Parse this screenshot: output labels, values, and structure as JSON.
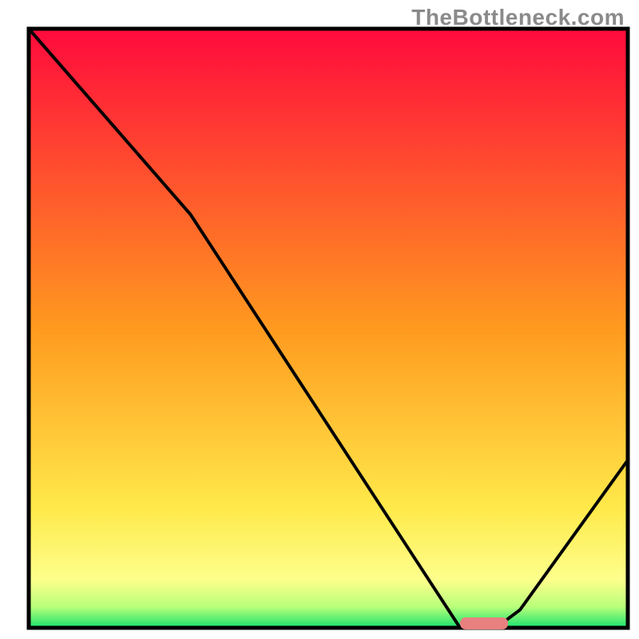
{
  "attribution": "TheBottleneck.com",
  "chart_data": {
    "type": "line",
    "title": "",
    "xlabel": "",
    "ylabel": "",
    "xlim": [
      0,
      100
    ],
    "ylim": [
      0,
      100
    ],
    "x": [
      0,
      27,
      72,
      78,
      82,
      100
    ],
    "values": [
      100,
      69,
      0,
      0,
      3,
      28
    ],
    "optimum_marker": {
      "x_start": 72,
      "x_end": 80,
      "y": 0
    },
    "background_gradient": {
      "stops": [
        {
          "pos": 0.0,
          "color": "#ff0a3c"
        },
        {
          "pos": 0.5,
          "color": "#ff9a1f"
        },
        {
          "pos": 0.8,
          "color": "#ffe94a"
        },
        {
          "pos": 0.92,
          "color": "#fdff8c"
        },
        {
          "pos": 0.965,
          "color": "#b8ff7a"
        },
        {
          "pos": 1.0,
          "color": "#17e36e"
        }
      ]
    }
  }
}
